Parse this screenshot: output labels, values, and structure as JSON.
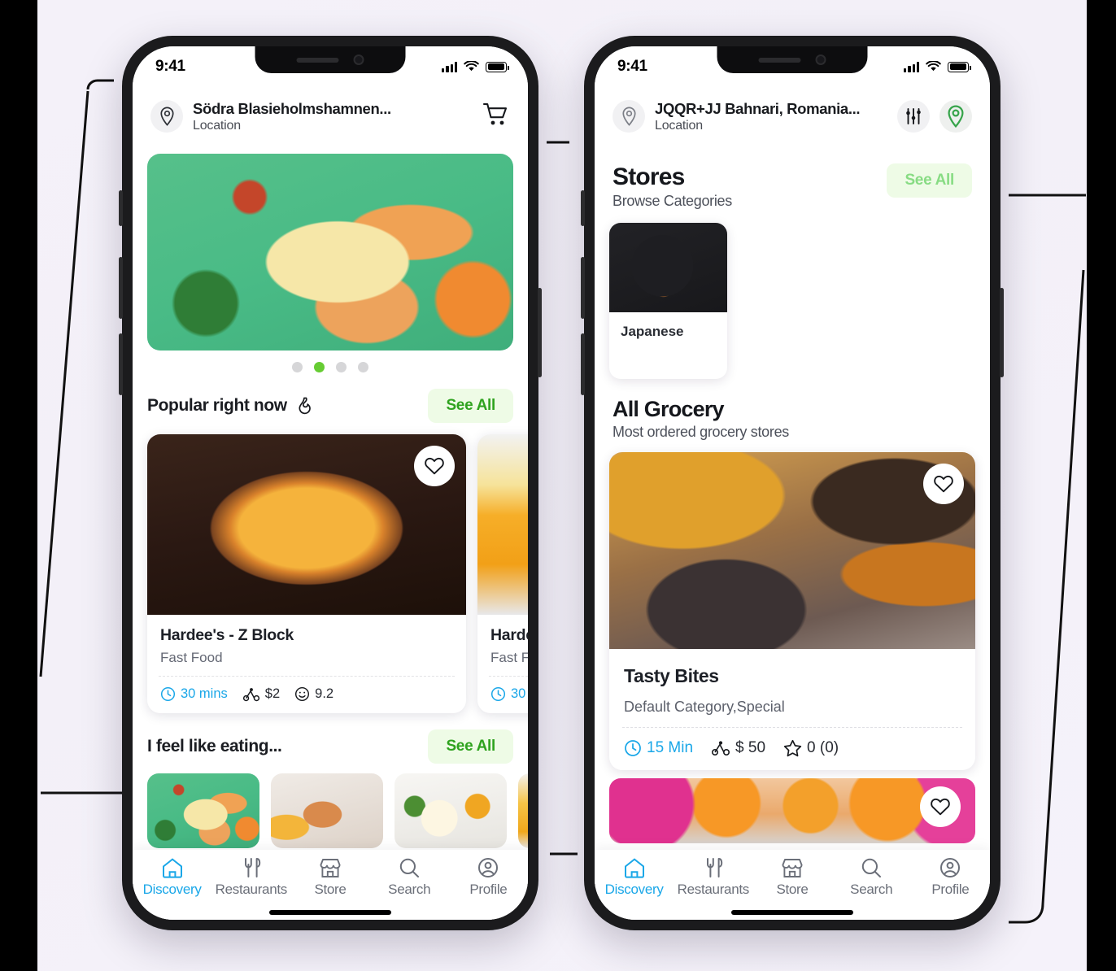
{
  "phone1": {
    "status": {
      "time": "9:41",
      "signal_icon": "cellular-bars-icon",
      "wifi_icon": "wifi-icon",
      "battery_icon": "battery-full-icon"
    },
    "header": {
      "pin_icon": "location-pin-icon",
      "title": "Södra Blasieholmshamnen...",
      "subtitle": "Location",
      "cart_icon": "shopping-cart-icon"
    },
    "carousel": {
      "dots": 4,
      "active_index": 1,
      "slide_alt": "tacos-plate-photo"
    },
    "popular": {
      "title": "Popular right now",
      "flame_icon": "flame-icon",
      "see_all": "See All",
      "cards": [
        {
          "image": "pizza-photo",
          "name": "Hardee's - Z Block",
          "category": "Fast Food",
          "time": "30 mins",
          "delivery_fee": "$2",
          "rating": "9.2",
          "clock_icon": "clock-icon",
          "scooter_icon": "scooter-icon",
          "smiley_icon": "smiley-icon",
          "heart_icon": "heart-outline-icon"
        },
        {
          "image": "beer-photo",
          "name": "Harde",
          "category": "Fast Fo",
          "time": "30 m",
          "delivery_fee": "",
          "rating": "",
          "clock_icon": "clock-icon",
          "scooter_icon": "scooter-icon",
          "smiley_icon": "smiley-icon",
          "heart_icon": "heart-outline-icon"
        }
      ]
    },
    "eating": {
      "title": "I feel like eating...",
      "see_all": "See All",
      "items": [
        "tacos-thumb",
        "burger-thumb",
        "mayo-egg-thumb",
        "beer-thumb"
      ]
    },
    "tabs": [
      {
        "label": "Discovery",
        "icon": "home-icon",
        "active": true
      },
      {
        "label": "Restaurants",
        "icon": "fork-knife-icon",
        "active": false
      },
      {
        "label": "Store",
        "icon": "storefront-icon",
        "active": false
      },
      {
        "label": "Search",
        "icon": "magnifier-icon",
        "active": false
      },
      {
        "label": "Profile",
        "icon": "user-circle-icon",
        "active": false
      }
    ]
  },
  "phone2": {
    "status": {
      "time": "9:41",
      "signal_icon": "cellular-bars-icon",
      "wifi_icon": "wifi-icon",
      "battery_icon": "battery-full-icon"
    },
    "header": {
      "pin_icon": "location-pin-icon",
      "title": "JQQR+JJ Bahnari, Romania...",
      "subtitle": "Location",
      "filter_icon": "sliders-filter-icon",
      "map_pin_icon": "map-pin-green-icon"
    },
    "stores": {
      "title": "Stores",
      "subtitle": "Browse Categories",
      "see_all": "See All",
      "categories": [
        {
          "name": "Japanese",
          "image": "sushi-photo"
        }
      ]
    },
    "grocery": {
      "title": "All Grocery",
      "subtitle": "Most ordered grocery stores",
      "cards": [
        {
          "image": "restaurant-interior-photo",
          "name": "Tasty Bites",
          "category": "Default Category,Special",
          "time": "15 Min",
          "delivery_fee": "$ 50",
          "rating": "0 (0)",
          "clock_icon": "clock-icon",
          "scooter_icon": "scooter-icon",
          "star_icon": "star-outline-icon",
          "heart_icon": "heart-outline-icon"
        },
        {
          "image": "fruit-market-photo",
          "name": "",
          "category": "",
          "heart_icon": "heart-outline-icon"
        }
      ]
    },
    "tabs": [
      {
        "label": "Discovery",
        "icon": "home-icon",
        "active": true
      },
      {
        "label": "Restaurants",
        "icon": "fork-knife-icon",
        "active": false
      },
      {
        "label": "Store",
        "icon": "storefront-icon",
        "active": false
      },
      {
        "label": "Search",
        "icon": "magnifier-icon",
        "active": false
      },
      {
        "label": "Profile",
        "icon": "user-circle-icon",
        "active": false
      }
    ]
  },
  "colors": {
    "accent_green": "#2fa31f",
    "accent_green_bg": "#eefbe6",
    "dot_active": "#66cc33",
    "tab_active": "#1aa7e8",
    "page_bg": "#f4f1f9",
    "frame": "#1b1b1d"
  }
}
